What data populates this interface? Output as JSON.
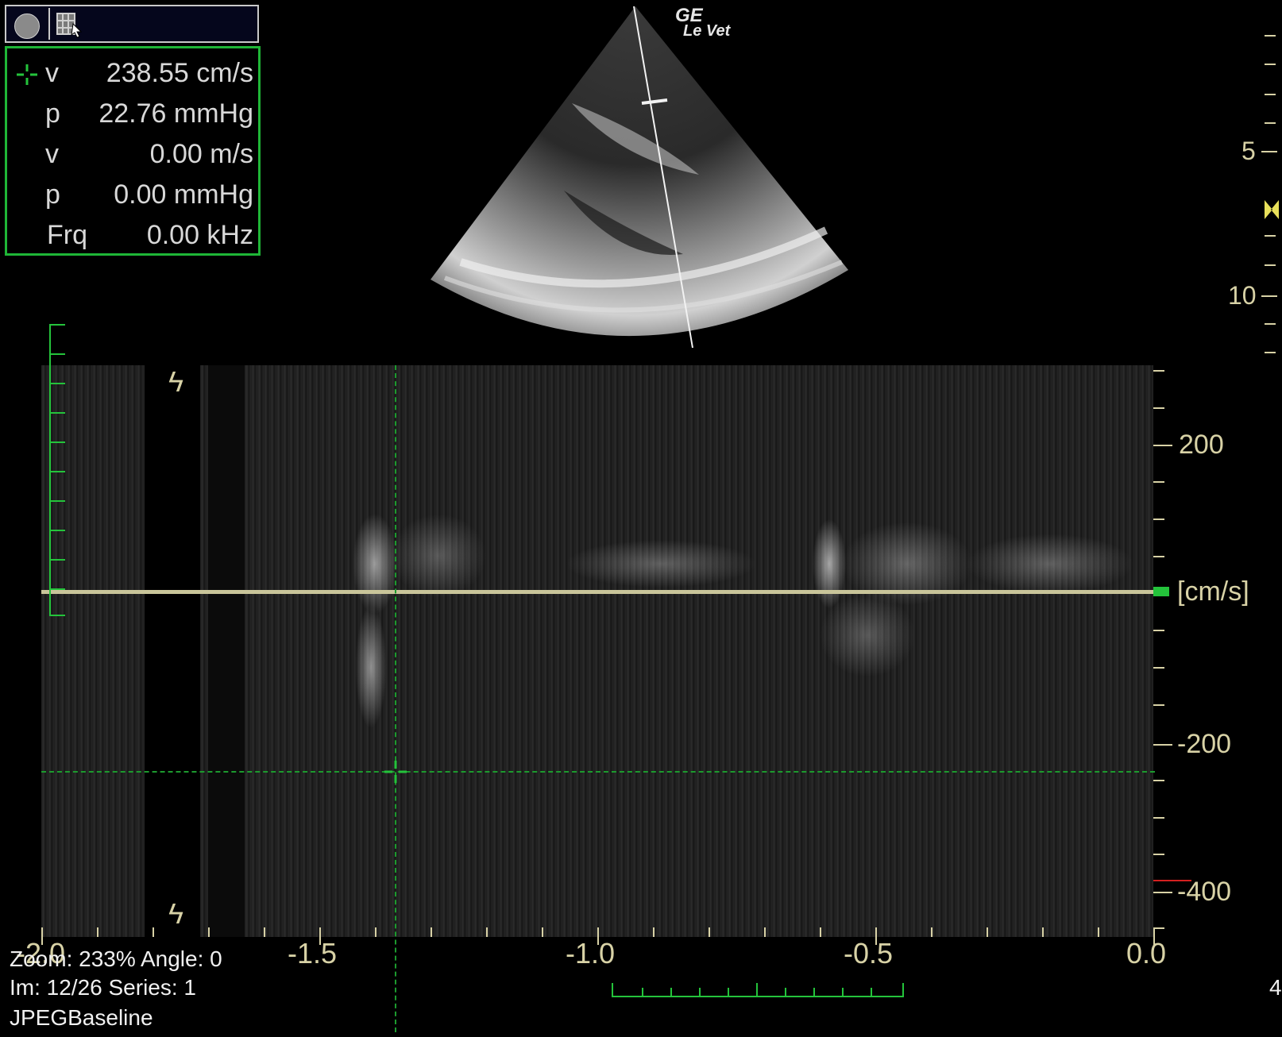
{
  "measurements": [
    {
      "label": "v",
      "value": "238.55 cm/s"
    },
    {
      "label": "p",
      "value": "22.76 mmHg"
    },
    {
      "label": "v",
      "value": "0.00 m/s"
    },
    {
      "label": "p",
      "value": "0.00 mmHg"
    },
    {
      "label": "Frq",
      "value": "0.00 kHz"
    }
  ],
  "logo": {
    "brand": "GE",
    "model": "Le Vet"
  },
  "depth_scale": {
    "labels": [
      "5",
      "10"
    ]
  },
  "velocity_scale": {
    "labels": [
      "200",
      "-200",
      "-400"
    ],
    "unit": "[cm/s]"
  },
  "time_axis": {
    "labels": [
      "-2.0",
      "-1.5",
      "-1.0",
      "-0.5",
      "0.0"
    ]
  },
  "info": {
    "zoom_line": "Zoom: 233% Angle: 0",
    "image_line": "Im: 12/26  Series:  1",
    "format_line": "JPEGBaseline",
    "edge_label": "4"
  },
  "colors": {
    "measurement_border": "#1fb637",
    "scale_text": "#d8d2a6",
    "cursor": "#1c9a2e"
  },
  "icons": [
    "record-icon",
    "image-grid-icon",
    "crosshair-icon",
    "ecg-trigger-icon",
    "focus-marker-icon"
  ]
}
